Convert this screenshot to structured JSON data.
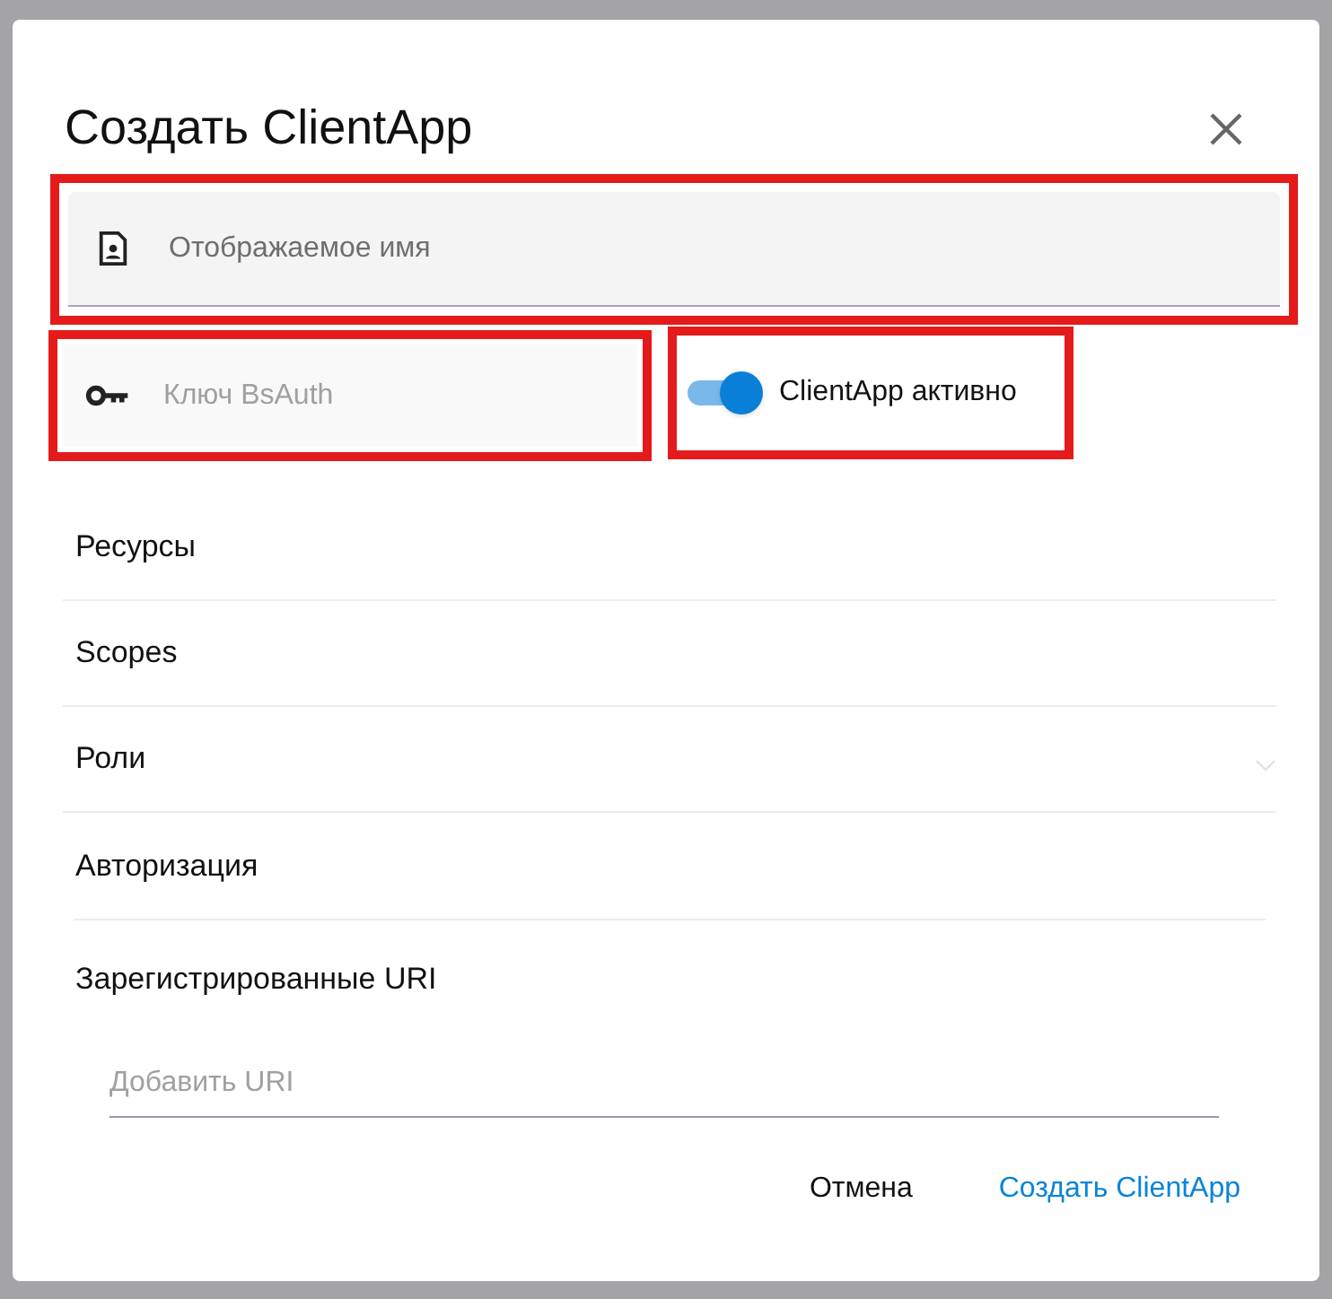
{
  "dialog": {
    "title": "Создать ClientApp"
  },
  "display_name": {
    "placeholder": "Отображаемое имя",
    "highlighted": true
  },
  "key_field": {
    "placeholder": "Ключ BsAuth",
    "highlighted": true
  },
  "active_toggle": {
    "label": "ClientApp активно",
    "on": true,
    "highlighted": true
  },
  "sections": [
    {
      "label": "Ресурсы",
      "expandable": false
    },
    {
      "label": "Scopes",
      "expandable": false
    },
    {
      "label": "Роли",
      "expandable": true
    },
    {
      "label": "Авторизация",
      "expandable": false
    }
  ],
  "uris": {
    "heading": "Зарегистрированные URI",
    "placeholder": "Добавить URI"
  },
  "buttons": [
    {
      "label": "Отмена",
      "kind": "text"
    },
    {
      "label": "Создать ClientApp",
      "kind": "primary"
    }
  ]
}
